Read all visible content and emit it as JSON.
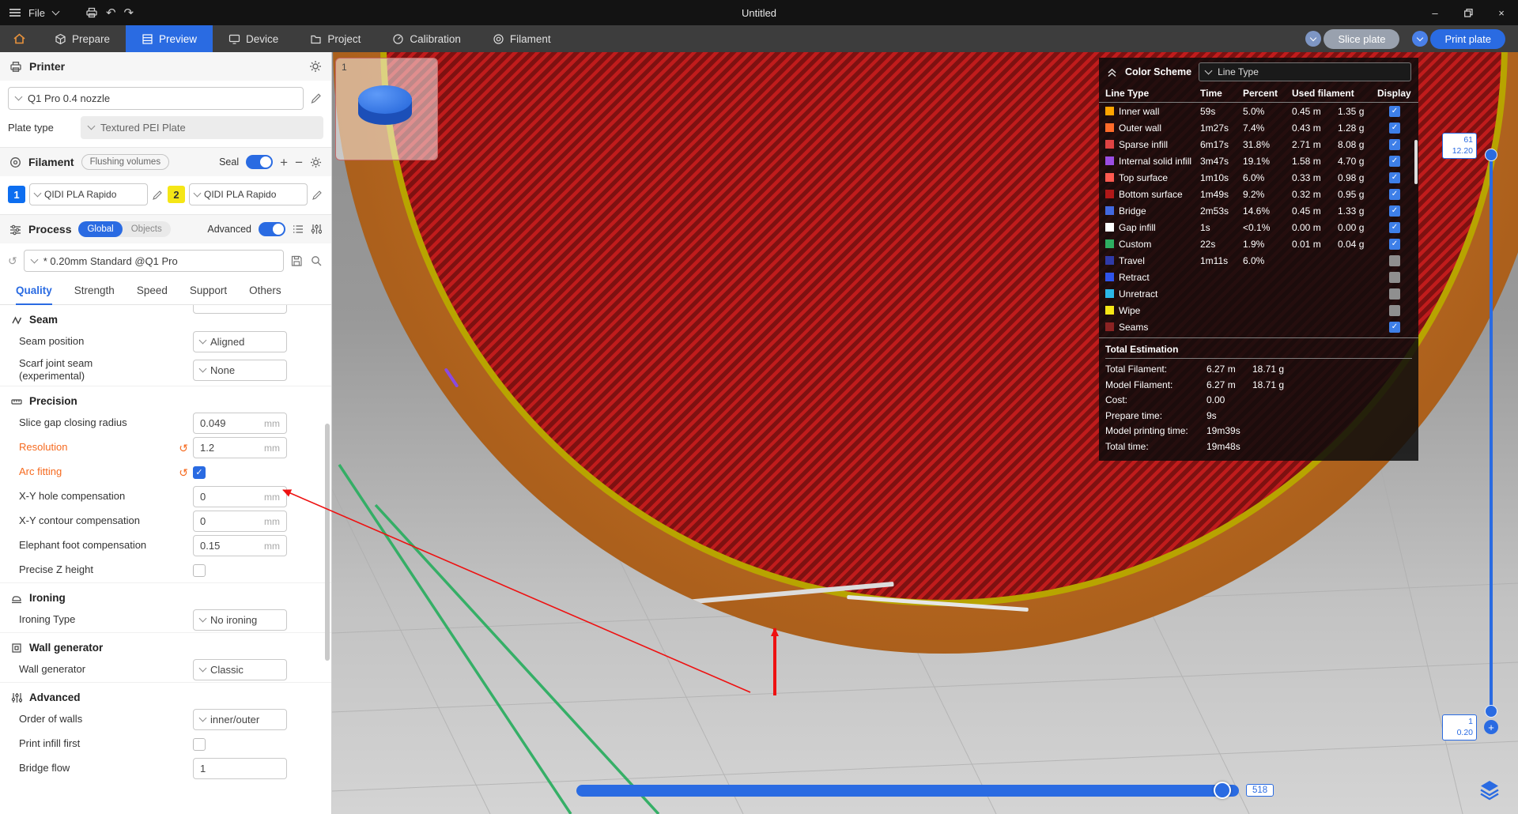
{
  "colors": {
    "accent": "#2a6be2",
    "modified_orange": "#f66a1f",
    "annotation_red": "#ee1111",
    "travel_green": "#2eae62",
    "infill_red_bright": "#c01c1c",
    "infill_red_dark": "#7e1111",
    "wall_brown": "#a85a1e",
    "wall_yellow": "#b8a400"
  },
  "titlebar": {
    "file_menu": "File",
    "title": "Untitled"
  },
  "navbar": {
    "tabs": [
      {
        "label": "Prepare"
      },
      {
        "label": "Preview"
      },
      {
        "label": "Device"
      },
      {
        "label": "Project"
      },
      {
        "label": "Calibration"
      },
      {
        "label": "Filament"
      }
    ],
    "slice_plate": "Slice plate",
    "print_plate": "Print plate"
  },
  "printer": {
    "section_title": "Printer",
    "machine": "Q1 Pro 0.4 nozzle",
    "plate_type_label": "Plate type",
    "plate_type_value": "Textured PEI Plate"
  },
  "filament": {
    "section_title": "Filament",
    "flushing_volumes": "Flushing volumes",
    "seal_label": "Seal",
    "slots": [
      {
        "index": "1",
        "color": "#0d6ef0",
        "name": "QIDI PLA Rapido"
      },
      {
        "index": "2",
        "color": "#f5e616",
        "name": "QIDI PLA Rapido"
      }
    ]
  },
  "process": {
    "section_title": "Process",
    "scope_global": "Global",
    "scope_objects": "Objects",
    "advanced_label": "Advanced",
    "preset": "* 0.20mm Standard @Q1 Pro",
    "tabs": [
      "Quality",
      "Strength",
      "Speed",
      "Support",
      "Others"
    ]
  },
  "settings": {
    "unit_mm": "mm",
    "seam_title": "Seam",
    "seam_position_label": "Seam position",
    "seam_position_value": "Aligned",
    "scarf_label_line1": "Scarf joint seam",
    "scarf_label_line2": "(experimental)",
    "scarf_value": "None",
    "precision_title": "Precision",
    "slice_gap_label": "Slice gap closing radius",
    "slice_gap_value": "0.049",
    "resolution_label": "Resolution",
    "resolution_value": "1.2",
    "arc_fitting_label": "Arc fitting",
    "xy_hole_label": "X-Y hole compensation",
    "xy_hole_value": "0",
    "xy_contour_label": "X-Y contour compensation",
    "xy_contour_value": "0",
    "elephant_label": "Elephant foot compensation",
    "elephant_value": "0.15",
    "precise_z_label": "Precise Z height",
    "ironing_title": "Ironing",
    "ironing_type_label": "Ironing Type",
    "ironing_type_value": "No ironing",
    "wall_generator_title": "Wall generator",
    "wall_generator_label": "Wall generator",
    "wall_generator_value": "Classic",
    "advanced_title": "Advanced",
    "order_walls_label": "Order of walls",
    "order_walls_value": "inner/outer",
    "print_infill_first_label": "Print infill first",
    "bridge_flow_label": "Bridge flow",
    "bridge_flow_value": "1"
  },
  "legend": {
    "scheme_label": "Color Scheme",
    "scheme_value": "Line Type",
    "headers": {
      "line_type": "Line Type",
      "time": "Time",
      "percent": "Percent",
      "used_filament": "Used filament",
      "display": "Display"
    },
    "rows": [
      {
        "name": "Inner wall",
        "color": "#FFA500",
        "time": "59s",
        "percent": "5.0%",
        "fil_m": "0.45 m",
        "fil_g": "1.35 g",
        "checked": true
      },
      {
        "name": "Outer wall",
        "color": "#FF6B2A",
        "time": "1m27s",
        "percent": "7.4%",
        "fil_m": "0.43 m",
        "fil_g": "1.28 g",
        "checked": true
      },
      {
        "name": "Sparse infill",
        "color": "#E04343",
        "time": "6m17s",
        "percent": "31.8%",
        "fil_m": "2.71 m",
        "fil_g": "8.08 g",
        "checked": true
      },
      {
        "name": "Internal solid infill",
        "color": "#9B4DE3",
        "time": "3m47s",
        "percent": "19.1%",
        "fil_m": "1.58 m",
        "fil_g": "4.70 g",
        "checked": true
      },
      {
        "name": "Top surface",
        "color": "#FF5A50",
        "time": "1m10s",
        "percent": "6.0%",
        "fil_m": "0.33 m",
        "fil_g": "0.98 g",
        "checked": true
      },
      {
        "name": "Bottom surface",
        "color": "#B01818",
        "time": "1m49s",
        "percent": "9.2%",
        "fil_m": "0.32 m",
        "fil_g": "0.95 g",
        "checked": true
      },
      {
        "name": "Bridge",
        "color": "#4169E1",
        "time": "2m53s",
        "percent": "14.6%",
        "fil_m": "0.45 m",
        "fil_g": "1.33 g",
        "checked": true
      },
      {
        "name": "Gap infill",
        "color": "#FFFFFF",
        "time": "1s",
        "percent": "<0.1%",
        "fil_m": "0.00 m",
        "fil_g": "0.00 g",
        "checked": true
      },
      {
        "name": "Custom",
        "color": "#2EAE62",
        "time": "22s",
        "percent": "1.9%",
        "fil_m": "0.01 m",
        "fil_g": "0.04 g",
        "checked": true
      },
      {
        "name": "Travel",
        "color": "#2F3AA8",
        "time": "1m11s",
        "percent": "6.0%",
        "fil_m": "",
        "fil_g": "",
        "checked": false
      },
      {
        "name": "Retract",
        "color": "#2F54EB",
        "time": "",
        "percent": "",
        "fil_m": "",
        "fil_g": "",
        "checked": false
      },
      {
        "name": "Unretract",
        "color": "#2BB8E8",
        "time": "",
        "percent": "",
        "fil_m": "",
        "fil_g": "",
        "checked": false
      },
      {
        "name": "Wipe",
        "color": "#F6E616",
        "time": "",
        "percent": "",
        "fil_m": "",
        "fil_g": "",
        "checked": false
      },
      {
        "name": "Seams",
        "color": "#8B2323",
        "time": "",
        "percent": "",
        "fil_m": "",
        "fil_g": "",
        "checked": true
      }
    ],
    "totals_title": "Total Estimation",
    "totals": [
      {
        "label": "Total Filament:",
        "v1": "6.27 m",
        "v2": "18.71 g"
      },
      {
        "label": "Model Filament:",
        "v1": "6.27 m",
        "v2": "18.71 g"
      },
      {
        "label": "Cost:",
        "v1": "0.00",
        "v2": ""
      },
      {
        "label": "Prepare time:",
        "v1": "9s",
        "v2": ""
      },
      {
        "label": "Model printing time:",
        "v1": "19m39s",
        "v2": ""
      },
      {
        "label": "Total time:",
        "v1": "19m48s",
        "v2": ""
      }
    ]
  },
  "viewport": {
    "plate_number": "1",
    "layer_slider": {
      "top_layer": "61",
      "top_height": "12.20",
      "bottom_layer": "1",
      "bottom_height": "0.20"
    },
    "horizontal_slider_value": "518"
  }
}
